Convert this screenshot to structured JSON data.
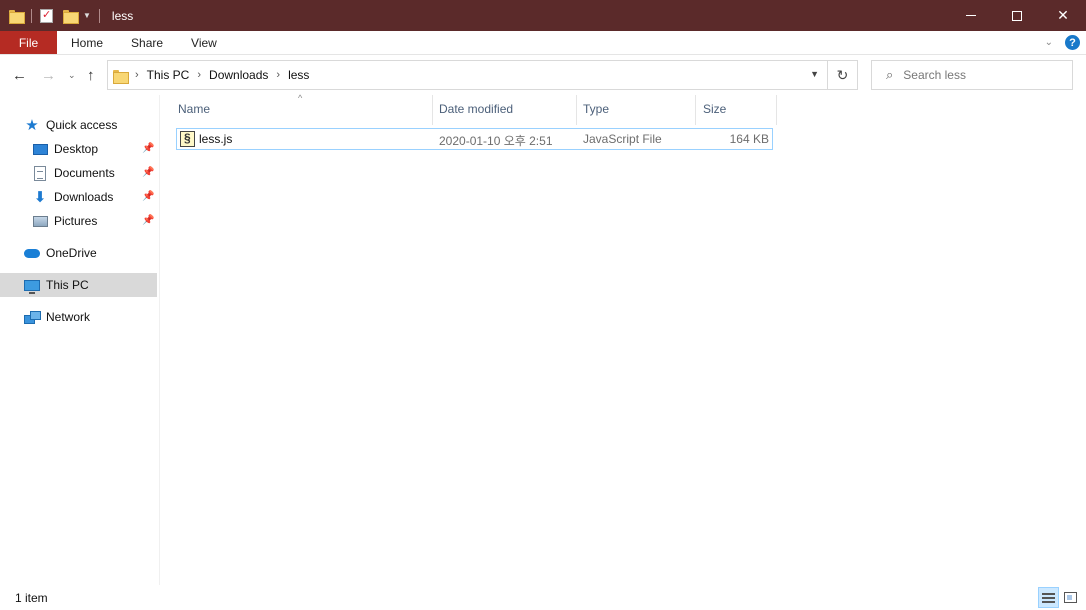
{
  "window": {
    "title": "less"
  },
  "ribbon": {
    "tabs": [
      "File",
      "Home",
      "Share",
      "View"
    ]
  },
  "address": {
    "crumbs": [
      "This PC",
      "Downloads",
      "less"
    ]
  },
  "search": {
    "placeholder": "Search less"
  },
  "sidebar": {
    "items": [
      {
        "label": "Quick access",
        "icon": "star-icon"
      },
      {
        "label": "Desktop",
        "icon": "desktop-icon",
        "pinned": true
      },
      {
        "label": "Documents",
        "icon": "documents-icon",
        "pinned": true
      },
      {
        "label": "Downloads",
        "icon": "downloads-icon",
        "pinned": true
      },
      {
        "label": "Pictures",
        "icon": "pictures-icon",
        "pinned": true
      },
      {
        "label": "OneDrive",
        "icon": "onedrive-icon"
      },
      {
        "label": "This PC",
        "icon": "this-pc-icon",
        "selected": true
      },
      {
        "label": "Network",
        "icon": "network-icon"
      }
    ]
  },
  "columns": {
    "name": "Name",
    "date": "Date modified",
    "type": "Type",
    "size": "Size"
  },
  "files": [
    {
      "name": "less.js",
      "date": "2020-01-10 오후 2:51",
      "type": "JavaScript File",
      "size": "164 KB",
      "icon": "javascript-file-icon"
    }
  ],
  "status": {
    "item_count": "1 item"
  },
  "colors": {
    "titlebar": "#5b2a2a",
    "file_tab": "#b52b23",
    "selection_border": "#99d1ff",
    "selected_nav": "#d9d9d9"
  }
}
